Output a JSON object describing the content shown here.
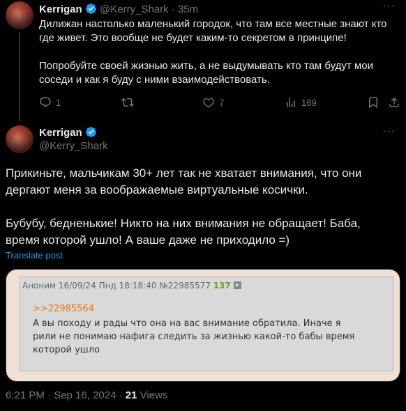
{
  "reply_tweet": {
    "name": "Kerrigan",
    "handle": "@Kerry_Shark",
    "time": "· 35m",
    "text_p1": "Дилижан настолько маленький городок, что там все местные знают кто где живет. Это вообще не будет каким-то секретом в принципе!",
    "text_p2": "Попробуйте своей жизнью жить, а не выдумывать кто там будут мои соседи и как я буду с ними взаимодействовать.",
    "replies": "1",
    "retweets": "",
    "likes": "7",
    "views": "189"
  },
  "main_tweet": {
    "name": "Kerrigan",
    "handle": "@Kerry_Shark",
    "text_p1": "Прикиньте, мальчикам 30+ лет так не хватает внимания, что они дергают меня за воображаемые виртуальные косички.",
    "text_p2": "Бубубу, бедненькие! Никто на них внимания не обращает! Баба, время которой ушло! А ваше даже не приходило =)",
    "translate": "Translate post",
    "timestamp": "6:21 PM · Sep 16, 2024 · ",
    "views_count": "21",
    "views_label": " Views"
  },
  "embedded_post": {
    "header": "Аноним 16/09/24 Пнд 18:18:40 №22985577",
    "reply_number": "137",
    "quote_link": ">>22985564",
    "body": "А вы походу и рады что она на вас внимание обратила. Иначе я рили не понимаю нафига следить за жизнью какой-то бабы время которой ушло"
  },
  "colors": {
    "background": "#000000",
    "text": "#e7e9ea",
    "muted": "#71767b",
    "accent": "#1d9bf0",
    "verified": "#1d9bf0",
    "link_orange": "#e67c0f",
    "reply_count_green": "#789922"
  },
  "icons": [
    "verified-badge-icon",
    "more-icon",
    "reply-icon",
    "retweet-icon",
    "like-icon",
    "views-icon",
    "bookmark-icon",
    "share-icon",
    "expand-icon"
  ]
}
